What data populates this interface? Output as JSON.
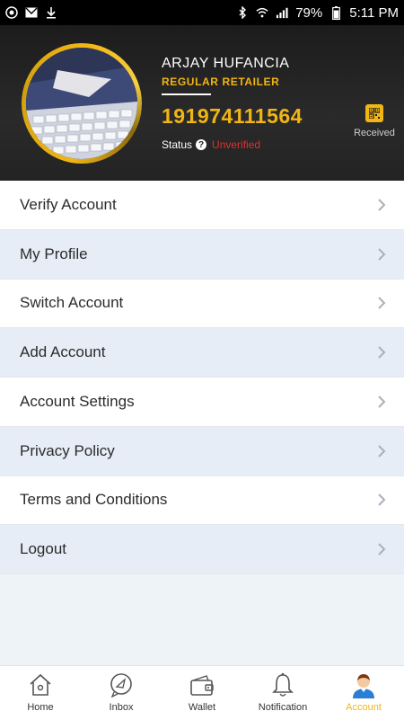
{
  "statusbar": {
    "battery": "79%",
    "time": "5:11 PM",
    "icons_left": [
      "app-icon",
      "mail-icon",
      "download-icon"
    ],
    "icons_right": [
      "bluetooth-icon",
      "wifi-icon",
      "signal-icon",
      "battery-icon"
    ]
  },
  "profile": {
    "name": "ARJAY HUFANCIA",
    "role": "REGULAR RETAILER",
    "phone": "191974111564",
    "status_label": "Status",
    "status_value": "Unverified",
    "received_label": "Received"
  },
  "menu": {
    "items": [
      {
        "label": "Verify Account"
      },
      {
        "label": "My Profile"
      },
      {
        "label": "Switch Account"
      },
      {
        "label": "Add Account"
      },
      {
        "label": "Account Settings"
      },
      {
        "label": "Privacy Policy"
      },
      {
        "label": "Terms and Conditions"
      },
      {
        "label": "Logout"
      }
    ]
  },
  "bottom_nav": {
    "items": [
      {
        "label": "Home",
        "icon": "home-icon"
      },
      {
        "label": "Inbox",
        "icon": "inbox-icon"
      },
      {
        "label": "Wallet",
        "icon": "wallet-icon"
      },
      {
        "label": "Notification",
        "icon": "bell-icon"
      },
      {
        "label": "Account",
        "icon": "account-icon",
        "active": true
      }
    ]
  },
  "colors": {
    "accent": "#f1b514",
    "status_unverified": "#e2302c",
    "header_bg": "#1c1c1c",
    "row_alt": "#e6edf6"
  }
}
